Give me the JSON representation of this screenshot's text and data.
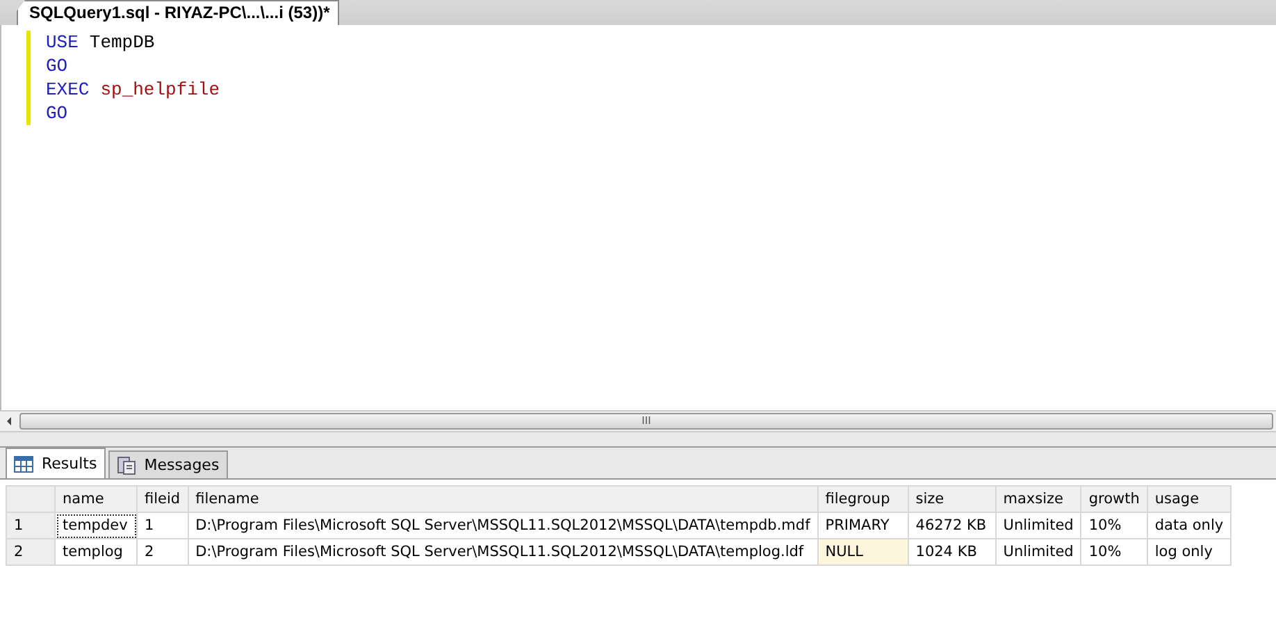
{
  "document_tab": {
    "title": "SQLQuery1.sql - RIYAZ-PC\\...\\...i (53))*"
  },
  "editor": {
    "lines": [
      {
        "tokens": [
          {
            "text": "USE",
            "kind": "keyword"
          },
          {
            "text": "TempDB",
            "kind": "plain"
          }
        ]
      },
      {
        "tokens": [
          {
            "text": "GO",
            "kind": "keyword"
          }
        ]
      },
      {
        "tokens": [
          {
            "text": "EXEC",
            "kind": "keyword"
          },
          {
            "text": "sp_helpfile",
            "kind": "procedure"
          }
        ]
      },
      {
        "tokens": [
          {
            "text": "GO",
            "kind": "keyword"
          }
        ]
      }
    ]
  },
  "scrollbar_grip": "III",
  "result_tabs": [
    {
      "label": "Results",
      "selected": true
    },
    {
      "label": "Messages",
      "selected": false
    }
  ],
  "grid": {
    "columns": [
      "name",
      "fileid",
      "filename",
      "filegroup",
      "size",
      "maxsize",
      "growth",
      "usage"
    ],
    "rows": [
      {
        "number": "1",
        "cells": [
          {
            "text": "tempdev",
            "kind": "value",
            "selected": true
          },
          {
            "text": "1",
            "kind": "value",
            "selected": false
          },
          {
            "text": "D:\\Program Files\\Microsoft SQL Server\\MSSQL11.SQL2012\\MSSQL\\DATA\\tempdb.mdf",
            "kind": "value",
            "selected": false
          },
          {
            "text": "PRIMARY",
            "kind": "value",
            "selected": false
          },
          {
            "text": "46272 KB",
            "kind": "value",
            "selected": false
          },
          {
            "text": "Unlimited",
            "kind": "value",
            "selected": false
          },
          {
            "text": "10%",
            "kind": "value",
            "selected": false
          },
          {
            "text": "data only",
            "kind": "value",
            "selected": false
          }
        ]
      },
      {
        "number": "2",
        "cells": [
          {
            "text": "templog",
            "kind": "value",
            "selected": false
          },
          {
            "text": "2",
            "kind": "value",
            "selected": false
          },
          {
            "text": "D:\\Program Files\\Microsoft SQL Server\\MSSQL11.SQL2012\\MSSQL\\DATA\\templog.ldf",
            "kind": "value",
            "selected": false
          },
          {
            "text": "NULL",
            "kind": "null",
            "selected": false
          },
          {
            "text": "1024 KB",
            "kind": "value",
            "selected": false
          },
          {
            "text": "Unlimited",
            "kind": "value",
            "selected": false
          },
          {
            "text": "10%",
            "kind": "value",
            "selected": false
          },
          {
            "text": "log only",
            "kind": "value",
            "selected": false
          }
        ]
      }
    ]
  }
}
